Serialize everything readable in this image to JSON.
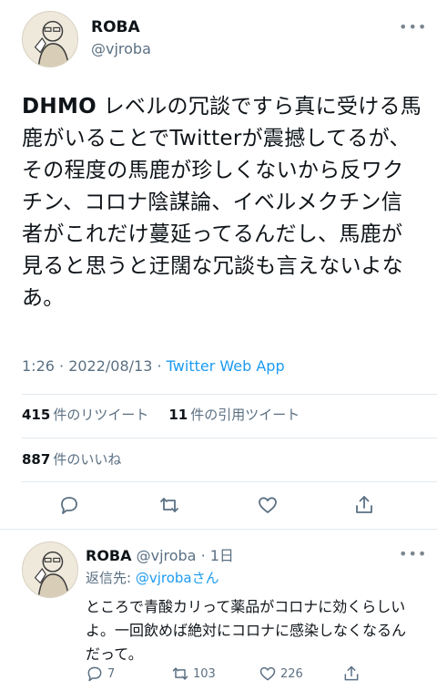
{
  "tweet": {
    "author_name": "ROBA",
    "author_handle": "@vjroba",
    "text_bold": "DHMO",
    "text_rest": "レベルの冗談ですら真に受ける馬鹿がいることでTwitterが震撼してるが、その程度の馬鹿が珍しくないから反ワクチン、コロナ陰謀論、イベルメクチン信者がこれだけ蔓延ってるんだし、馬鹿が見ると思うと迂闊な冗談も言えないよなあ。",
    "time": "1:26 · 2022/08/13 · ",
    "app": "Twitter Web App",
    "retweets_count": "415",
    "retweets_label": "件のリツイート",
    "quotes_count": "11",
    "quotes_label": "件の引用ツイート",
    "likes_count": "887",
    "likes_label": "件のいいね"
  },
  "reply": {
    "author_name": "ROBA",
    "author_handle_time": "@vjroba · 1日",
    "reply_to_prefix": "返信先: ",
    "reply_to_handle": "@vjroba",
    "reply_to_suffix": "さん",
    "text": "ところで青酸カリって薬品がコロナに効くらしいよ。一回飲めば絶対にコロナに感染しなくなるんだって。",
    "reply_count": "7",
    "retweet_count": "103",
    "like_count": "226"
  },
  "icons": [
    "more-icon",
    "reply-icon",
    "retweet-icon",
    "like-icon",
    "share-icon"
  ],
  "colors": {
    "link": "#1d9bf0",
    "muted": "#5b7083",
    "text": "#0f1419",
    "divider": "#e1e8ed"
  }
}
